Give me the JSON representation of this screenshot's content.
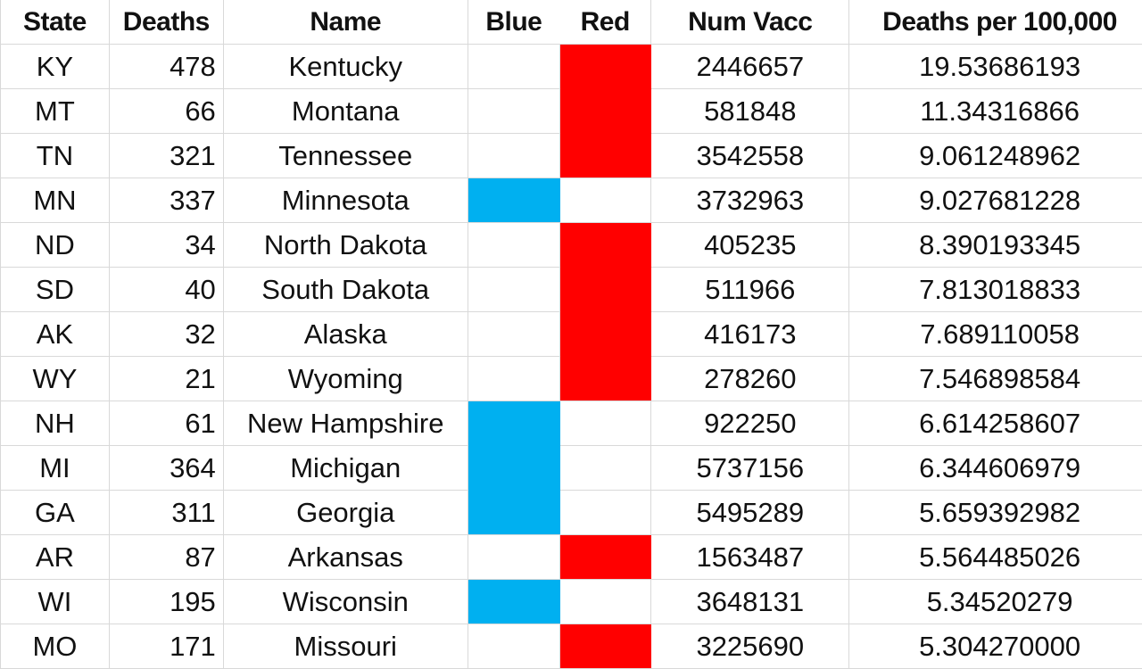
{
  "colors": {
    "blue": "#00B0F0",
    "red": "#FF0000",
    "gridline": "#D9D9D9"
  },
  "columns": [
    "State",
    "Deaths",
    "Name",
    "Blue",
    "Red",
    "Num Vacc",
    "Deaths per 100,000"
  ],
  "rows": [
    {
      "state": "KY",
      "deaths": "478",
      "name": "Kentucky",
      "party": "red",
      "num_vacc": "2446657",
      "deaths_per_100k": "19.53686193"
    },
    {
      "state": "MT",
      "deaths": "66",
      "name": "Montana",
      "party": "red",
      "num_vacc": "581848",
      "deaths_per_100k": "11.34316866"
    },
    {
      "state": "TN",
      "deaths": "321",
      "name": "Tennessee",
      "party": "red",
      "num_vacc": "3542558",
      "deaths_per_100k": "9.061248962"
    },
    {
      "state": "MN",
      "deaths": "337",
      "name": "Minnesota",
      "party": "blue",
      "num_vacc": "3732963",
      "deaths_per_100k": "9.027681228"
    },
    {
      "state": "ND",
      "deaths": "34",
      "name": "North Dakota",
      "party": "red",
      "num_vacc": "405235",
      "deaths_per_100k": "8.390193345"
    },
    {
      "state": "SD",
      "deaths": "40",
      "name": "South Dakota",
      "party": "red",
      "num_vacc": "511966",
      "deaths_per_100k": "7.813018833"
    },
    {
      "state": "AK",
      "deaths": "32",
      "name": "Alaska",
      "party": "red",
      "num_vacc": "416173",
      "deaths_per_100k": "7.689110058"
    },
    {
      "state": "WY",
      "deaths": "21",
      "name": "Wyoming",
      "party": "red",
      "num_vacc": "278260",
      "deaths_per_100k": "7.546898584"
    },
    {
      "state": "NH",
      "deaths": "61",
      "name": "New Hampshire",
      "party": "blue",
      "num_vacc": "922250",
      "deaths_per_100k": "6.614258607"
    },
    {
      "state": "MI",
      "deaths": "364",
      "name": "Michigan",
      "party": "blue",
      "num_vacc": "5737156",
      "deaths_per_100k": "6.344606979"
    },
    {
      "state": "GA",
      "deaths": "311",
      "name": "Georgia",
      "party": "blue",
      "num_vacc": "5495289",
      "deaths_per_100k": "5.659392982"
    },
    {
      "state": "AR",
      "deaths": "87",
      "name": "Arkansas",
      "party": "red",
      "num_vacc": "1563487",
      "deaths_per_100k": "5.564485026"
    },
    {
      "state": "WI",
      "deaths": "195",
      "name": "Wisconsin",
      "party": "blue",
      "num_vacc": "3648131",
      "deaths_per_100k": "5.34520279"
    },
    {
      "state": "MO",
      "deaths": "171",
      "name": "Missouri",
      "party": "red",
      "num_vacc": "3225690",
      "deaths_per_100k": "5.304270000"
    }
  ]
}
